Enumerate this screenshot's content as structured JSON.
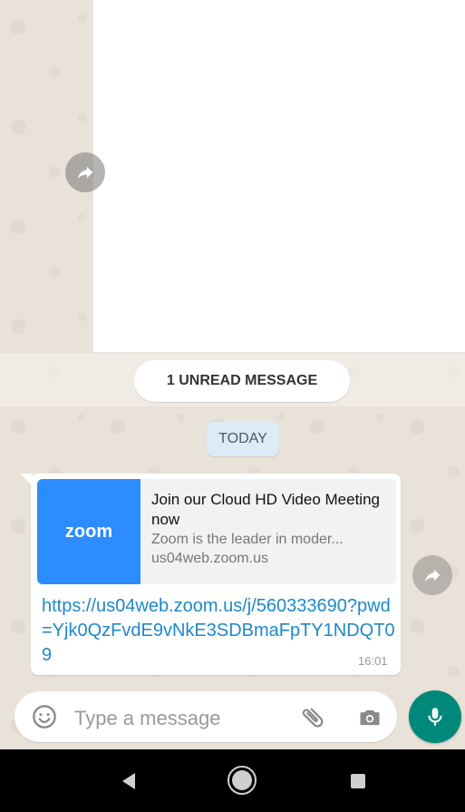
{
  "chat": {
    "unread_banner": "1 UNREAD MESSAGE",
    "date_chip": "TODAY"
  },
  "message": {
    "preview": {
      "logo_text": "zoom",
      "title": "Join our Cloud HD Video Meeting now",
      "description": "Zoom is the leader in moder...",
      "domain": "us04web.zoom.us"
    },
    "link": "https://us04web.zoom.us/j/560333690?pwd=Yjk0QzFvdE9vNkE3SDBmaFpTY1NDQT09",
    "time": "16:01"
  },
  "composer": {
    "placeholder": "Type a message"
  },
  "icons": {
    "emoji": "emoji-icon",
    "attach": "paperclip-icon",
    "camera": "camera-icon",
    "mic": "microphone-icon",
    "share": "share-icon"
  },
  "colors": {
    "accent": "#00897b",
    "link": "#1e88c8",
    "zoom_brand": "#2d8cff"
  }
}
